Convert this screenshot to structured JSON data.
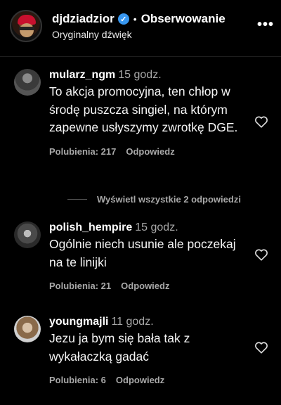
{
  "header": {
    "username": "djdziadzior",
    "verified_icon": "verified-badge-icon",
    "separator": "•",
    "follow_label": "Obserwowanie",
    "subtitle": "Oryginalny dźwięk",
    "more_label": "•••"
  },
  "comments": [
    {
      "user": "mularz_ngm",
      "time": "15 godz.",
      "text": "To akcja promocyjna, ten chłop w środę puszcza singiel, na którym zapewne usłyszymy zwrotkę DGE.",
      "likes": "Polubienia: 217",
      "reply": "Odpowiedz"
    },
    {
      "user": "polish_hempire",
      "time": "15 godz.",
      "text": "Ogólnie niech usunie ale poczekaj na te linijki",
      "likes": "Polubienia: 21",
      "reply": "Odpowiedz"
    },
    {
      "user": "youngmajli",
      "time": "11 godz.",
      "text": "Jezu ja bym się bała tak z wykałaczką gadać",
      "likes": "Polubienia: 6",
      "reply": "Odpowiedz"
    }
  ],
  "view_replies": "Wyświetl wszystkie 2 odpowiedzi",
  "colors": {
    "background": "#000000",
    "text": "#f5f5f5",
    "muted": "#a8a8a8",
    "verified": "#3897f0"
  }
}
